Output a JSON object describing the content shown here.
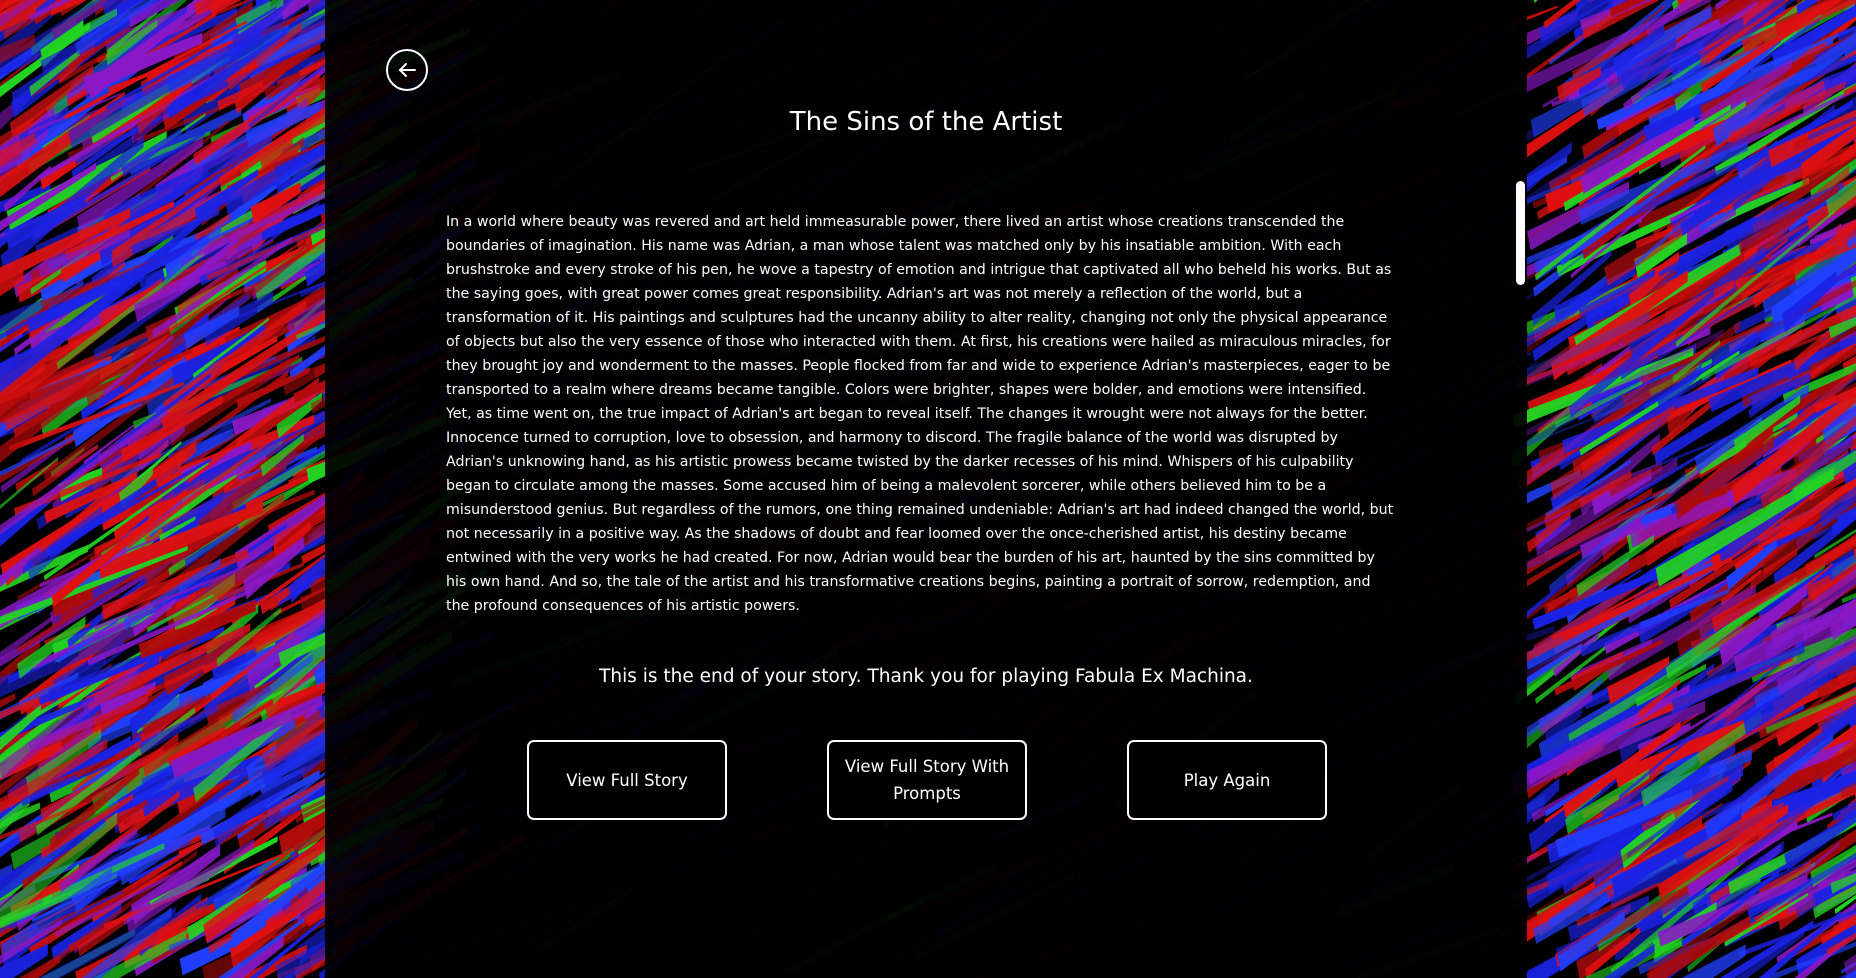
{
  "app": {
    "title": "The Sins of the Artist",
    "back_icon": "arrow-left-icon"
  },
  "story": {
    "text": "In a world where beauty was revered and art held immeasurable power, there lived an artist whose creations transcended the boundaries of imagination. His name was Adrian, a man whose talent was matched only by his insatiable ambition. With each brushstroke and every stroke of his pen, he wove a tapestry of emotion and intrigue that captivated all who beheld his works. But as the saying goes, with great power comes great responsibility. Adrian's art was not merely a reflection of the world, but a transformation of it. His paintings and sculptures had the uncanny ability to alter reality, changing not only the physical appearance of objects but also the very essence of those who interacted with them. At first, his creations were hailed as miraculous miracles, for they brought joy and wonderment to the masses. People flocked from far and wide to experience Adrian's masterpieces, eager to be transported to a realm where dreams became tangible. Colors were brighter, shapes were bolder, and emotions were intensified. Yet, as time went on, the true impact of Adrian's art began to reveal itself. The changes it wrought were not always for the better. Innocence turned to corruption, love to obsession, and harmony to discord. The fragile balance of the world was disrupted by Adrian's unknowing hand, as his artistic prowess became twisted by the darker recesses of his mind. Whispers of his culpability began to circulate among the masses. Some accused him of being a malevolent sorcerer, while others believed him to be a misunderstood genius. But regardless of the rumors, one thing remained undeniable: Adrian's art had indeed changed the world, but not necessarily in a positive way. As the shadows of doubt and fear loomed over the once-cherished artist, his destiny became entwined with the very works he had created. For now, Adrian would bear the burden of his art, haunted by the sins committed by his own hand. And so, the tale of the artist and his transformative creations begins, painting a portrait of sorrow, redemption, and the profound consequences of his artistic powers."
  },
  "end_message": "This is the end of your story. Thank you for playing Fabula Ex Machina.",
  "buttons": {
    "view_full_story": "View Full Story",
    "view_full_story_with_prompts": "View Full Story With Prompts",
    "play_again": "Play Again"
  },
  "colors": {
    "panel": "#000000",
    "text": "#ffffff",
    "accent_red": "#e01010",
    "accent_blue": "#1a22e6",
    "accent_green": "#22d422",
    "accent_purple": "#8a18c8"
  }
}
